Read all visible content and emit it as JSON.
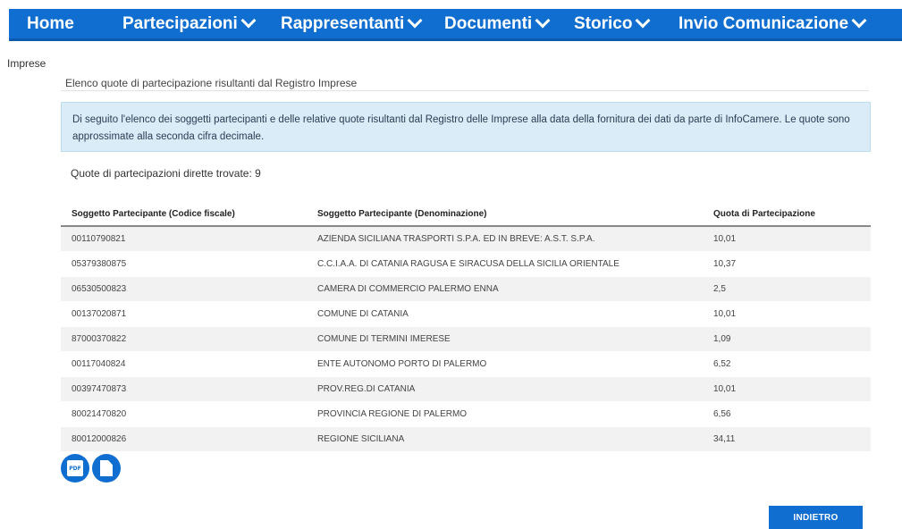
{
  "nav": {
    "home": "Home",
    "partecipazioni": "Partecipazioni",
    "rappresentanti": "Rappresentanti",
    "documenti": "Documenti",
    "storico": "Storico",
    "invio": "Invio Comunicazione"
  },
  "breadcrumb": "Imprese",
  "section_title": "Elenco quote di partecipazione risultanti dal Registro Imprese",
  "info_text": "Di seguito l'elenco dei soggetti partecipanti e delle relative quote risultanti dal Registro delle Imprese alla data della fornitura dei dati da parte di InfoCamere. Le quote sono approssimate alla seconda cifra decimale.",
  "count_text": "Quote di partecipazioni dirette trovate: 9",
  "table": {
    "headers": [
      "Soggetto Partecipante (Codice fiscale)",
      "Soggetto Partecipante (Denominazione)",
      "Quota di Partecipazione"
    ],
    "rows": [
      [
        "00110790821",
        "AZIENDA SICILIANA TRASPORTI S.P.A. ED IN BREVE: A.S.T. S.P.A.",
        "10,01"
      ],
      [
        "05379380875",
        "C.C.I.A.A. DI CATANIA RAGUSA E SIRACUSA DELLA SICILIA ORIENTALE",
        "10,37"
      ],
      [
        "06530500823",
        "CAMERA DI COMMERCIO PALERMO ENNA",
        "2,5"
      ],
      [
        "00137020871",
        "COMUNE DI CATANIA",
        "10,01"
      ],
      [
        "87000370822",
        "COMUNE DI TERMINI IMERESE",
        "1,09"
      ],
      [
        "00117040824",
        "ENTE AUTONOMO PORTO DI PALERMO",
        "6,52"
      ],
      [
        "00397470873",
        "PROV.REG.DI CATANIA",
        "10,01"
      ],
      [
        "80021470820",
        "PROVINCIA REGIONE DI PALERMO",
        "6,56"
      ],
      [
        "80012000826",
        "REGIONE SICILIANA",
        "34,11"
      ]
    ]
  },
  "icons": {
    "pdf": "pdf-export-icon",
    "doc": "document-export-icon",
    "pdf_label": "PDF"
  },
  "back_button": "INDIETRO",
  "colors": {
    "primary": "#0f6ed0",
    "info_bg": "#d9ecf7"
  }
}
